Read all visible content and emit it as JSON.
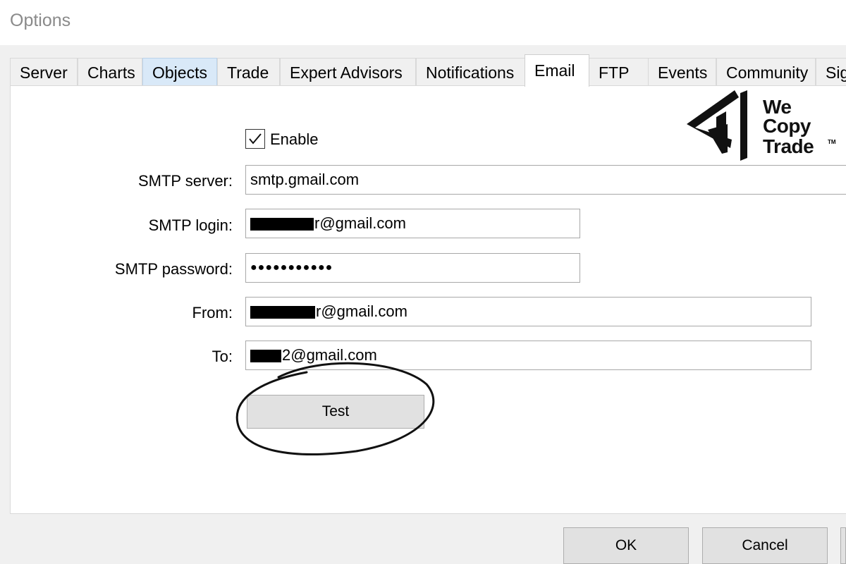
{
  "window": {
    "title": "Options"
  },
  "tabs": [
    {
      "label": "Server"
    },
    {
      "label": "Charts"
    },
    {
      "label": "Objects"
    },
    {
      "label": "Trade"
    },
    {
      "label": "Expert Advisors"
    },
    {
      "label": "Notifications"
    },
    {
      "label": "Email"
    },
    {
      "label": "FTP"
    },
    {
      "label": "Events"
    },
    {
      "label": "Community"
    },
    {
      "label": "Sig"
    }
  ],
  "email": {
    "enable_label": "Enable",
    "enable_checked": true,
    "smtp_server_label": "SMTP server:",
    "smtp_server_value": "smtp.gmail.com",
    "smtp_login_label": "SMTP login:",
    "smtp_login_value": "r@gmail.com",
    "smtp_password_label": "SMTP password:",
    "smtp_password_value": "●●●●●●●●●●●",
    "from_label": "From:",
    "from_value": "r@gmail.com",
    "to_label": "To:",
    "to_value": "2@gmail.com",
    "test_button": "Test"
  },
  "footer": {
    "ok_button": "OK",
    "cancel_button": "Cancel"
  },
  "logo": {
    "line1": "We",
    "line2": "Copy",
    "line3": "Trade",
    "trademark": "TM",
    "color": "#111111"
  },
  "colors": {
    "active_tab": "#ffffff",
    "hover_tab": "#d9e9f8",
    "window_bg": "#f0f0f0"
  }
}
